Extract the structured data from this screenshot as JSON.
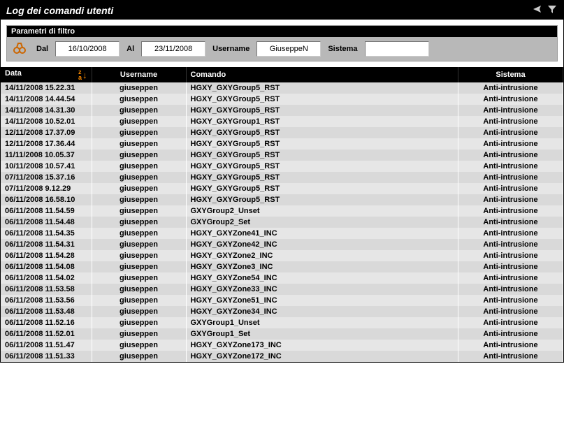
{
  "titlebar": {
    "title": "Log dei comandi utenti"
  },
  "filter": {
    "header": "Parametri di filtro",
    "dal_label": "Dal",
    "dal_value": "16/10/2008",
    "al_label": "Al",
    "al_value": "23/11/2008",
    "username_label": "Username",
    "username_value": "GiuseppeN",
    "sistema_label": "Sistema",
    "sistema_value": ""
  },
  "columns": {
    "data": "Data",
    "username": "Username",
    "comando": "Comando",
    "sistema": "Sistema"
  },
  "rows": [
    {
      "data": "14/11/2008 15.22.31",
      "user": "giuseppen",
      "cmd": "HGXY_GXYGroup5_RST",
      "sys": "Anti-intrusione"
    },
    {
      "data": "14/11/2008 14.44.54",
      "user": "giuseppen",
      "cmd": "HGXY_GXYGroup5_RST",
      "sys": "Anti-intrusione"
    },
    {
      "data": "14/11/2008 14.31.30",
      "user": "giuseppen",
      "cmd": "HGXY_GXYGroup5_RST",
      "sys": "Anti-intrusione"
    },
    {
      "data": "14/11/2008 10.52.01",
      "user": "giuseppen",
      "cmd": "HGXY_GXYGroup1_RST",
      "sys": "Anti-intrusione"
    },
    {
      "data": "12/11/2008 17.37.09",
      "user": "giuseppen",
      "cmd": "HGXY_GXYGroup5_RST",
      "sys": "Anti-intrusione"
    },
    {
      "data": "12/11/2008 17.36.44",
      "user": "giuseppen",
      "cmd": "HGXY_GXYGroup5_RST",
      "sys": "Anti-intrusione"
    },
    {
      "data": "11/11/2008 10.05.37",
      "user": "giuseppen",
      "cmd": "HGXY_GXYGroup5_RST",
      "sys": "Anti-intrusione"
    },
    {
      "data": "10/11/2008 10.57.41",
      "user": "giuseppen",
      "cmd": "HGXY_GXYGroup5_RST",
      "sys": "Anti-intrusione"
    },
    {
      "data": "07/11/2008 15.37.16",
      "user": "giuseppen",
      "cmd": "HGXY_GXYGroup5_RST",
      "sys": "Anti-intrusione"
    },
    {
      "data": "07/11/2008 9.12.29",
      "user": "giuseppen",
      "cmd": "HGXY_GXYGroup5_RST",
      "sys": "Anti-intrusione"
    },
    {
      "data": "06/11/2008 16.58.10",
      "user": "giuseppen",
      "cmd": "HGXY_GXYGroup5_RST",
      "sys": "Anti-intrusione"
    },
    {
      "data": "06/11/2008 11.54.59",
      "user": "giuseppen",
      "cmd": "GXYGroup2_Unset",
      "sys": "Anti-intrusione"
    },
    {
      "data": "06/11/2008 11.54.48",
      "user": "giuseppen",
      "cmd": "GXYGroup2_Set",
      "sys": "Anti-intrusione"
    },
    {
      "data": "06/11/2008 11.54.35",
      "user": "giuseppen",
      "cmd": "HGXY_GXYZone41_INC",
      "sys": "Anti-intrusione"
    },
    {
      "data": "06/11/2008 11.54.31",
      "user": "giuseppen",
      "cmd": "HGXY_GXYZone42_INC",
      "sys": "Anti-intrusione"
    },
    {
      "data": "06/11/2008 11.54.28",
      "user": "giuseppen",
      "cmd": "HGXY_GXYZone2_INC",
      "sys": "Anti-intrusione"
    },
    {
      "data": "06/11/2008 11.54.08",
      "user": "giuseppen",
      "cmd": "HGXY_GXYZone3_INC",
      "sys": "Anti-intrusione"
    },
    {
      "data": "06/11/2008 11.54.02",
      "user": "giuseppen",
      "cmd": "HGXY_GXYZone54_INC",
      "sys": "Anti-intrusione"
    },
    {
      "data": "06/11/2008 11.53.58",
      "user": "giuseppen",
      "cmd": "HGXY_GXYZone33_INC",
      "sys": "Anti-intrusione"
    },
    {
      "data": "06/11/2008 11.53.56",
      "user": "giuseppen",
      "cmd": "HGXY_GXYZone51_INC",
      "sys": "Anti-intrusione"
    },
    {
      "data": "06/11/2008 11.53.48",
      "user": "giuseppen",
      "cmd": "HGXY_GXYZone34_INC",
      "sys": "Anti-intrusione"
    },
    {
      "data": "06/11/2008 11.52.16",
      "user": "giuseppen",
      "cmd": "GXYGroup1_Unset",
      "sys": "Anti-intrusione"
    },
    {
      "data": "06/11/2008 11.52.01",
      "user": "giuseppen",
      "cmd": "GXYGroup1_Set",
      "sys": "Anti-intrusione"
    },
    {
      "data": "06/11/2008 11.51.47",
      "user": "giuseppen",
      "cmd": "HGXY_GXYZone173_INC",
      "sys": "Anti-intrusione"
    },
    {
      "data": "06/11/2008 11.51.33",
      "user": "giuseppen",
      "cmd": "HGXY_GXYZone172_INC",
      "sys": "Anti-intrusione"
    }
  ]
}
